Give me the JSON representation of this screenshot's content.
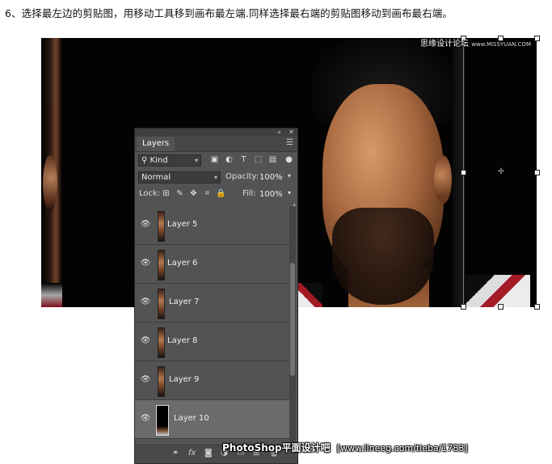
{
  "instruction": "6、选择最左边的剪贴图，用移动工具移到画布最左端.同样选择最右端的剪贴图移动到画布最右端。",
  "watermark_top": {
    "text": "思缘设计论坛",
    "small": "www.MISSYUAN.COM"
  },
  "watermark_bottom": {
    "brand": "PhotoShop平面设计吧",
    "url": "[www.lineeg.com/tieba/1783]"
  },
  "panel": {
    "tab": "Layers",
    "filter": {
      "label": "Kind"
    },
    "blend": {
      "mode": "Normal",
      "opacity_label": "Opacity:",
      "opacity_value": "100%"
    },
    "lock": {
      "label": "Lock:",
      "fill_label": "Fill:",
      "fill_value": "100%"
    },
    "layers": [
      {
        "name": "Layer 5",
        "visible": true,
        "selected": false
      },
      {
        "name": "Layer 6",
        "visible": true,
        "selected": false
      },
      {
        "name": "Layer 7",
        "visible": true,
        "selected": false
      },
      {
        "name": "Layer 8",
        "visible": true,
        "selected": false
      },
      {
        "name": "Layer 9",
        "visible": true,
        "selected": false
      },
      {
        "name": "Layer 10",
        "visible": true,
        "selected": true
      }
    ],
    "footer_icons": [
      "link-icon",
      "fx-icon",
      "mask-icon",
      "adjustment-icon",
      "group-icon",
      "new-layer-icon",
      "trash-icon"
    ]
  }
}
